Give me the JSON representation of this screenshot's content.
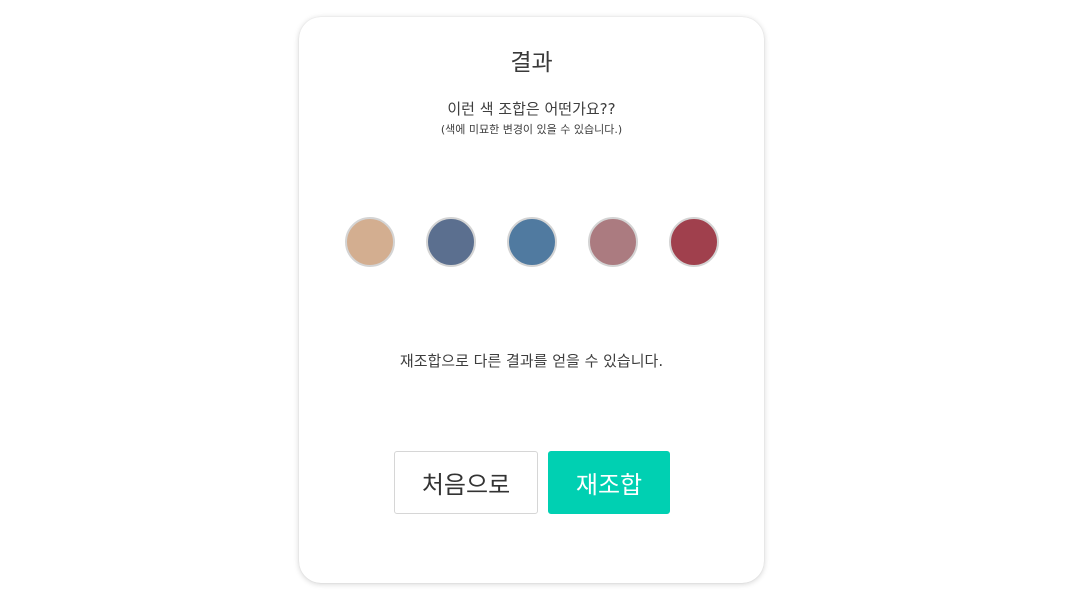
{
  "card": {
    "title": "결과",
    "question": "이런 색 조합은 어떤가요??",
    "note": "(색에 미묘한 변경이 있을 수 있습니다.)",
    "hint": "재조합으로 다른 결과를 얻을 수 있습니다."
  },
  "palette": [
    {
      "color": "#d3ae90"
    },
    {
      "color": "#5b6f8f"
    },
    {
      "color": "#507aa0"
    },
    {
      "color": "#ab7b80"
    },
    {
      "color": "#a0404d"
    }
  ],
  "buttons": {
    "home_label": "처음으로",
    "remix_label": "재조합"
  },
  "colors": {
    "accent": "#00d0b2",
    "text": "#3e3e3e",
    "swatch_border": "#d4d4d4"
  }
}
